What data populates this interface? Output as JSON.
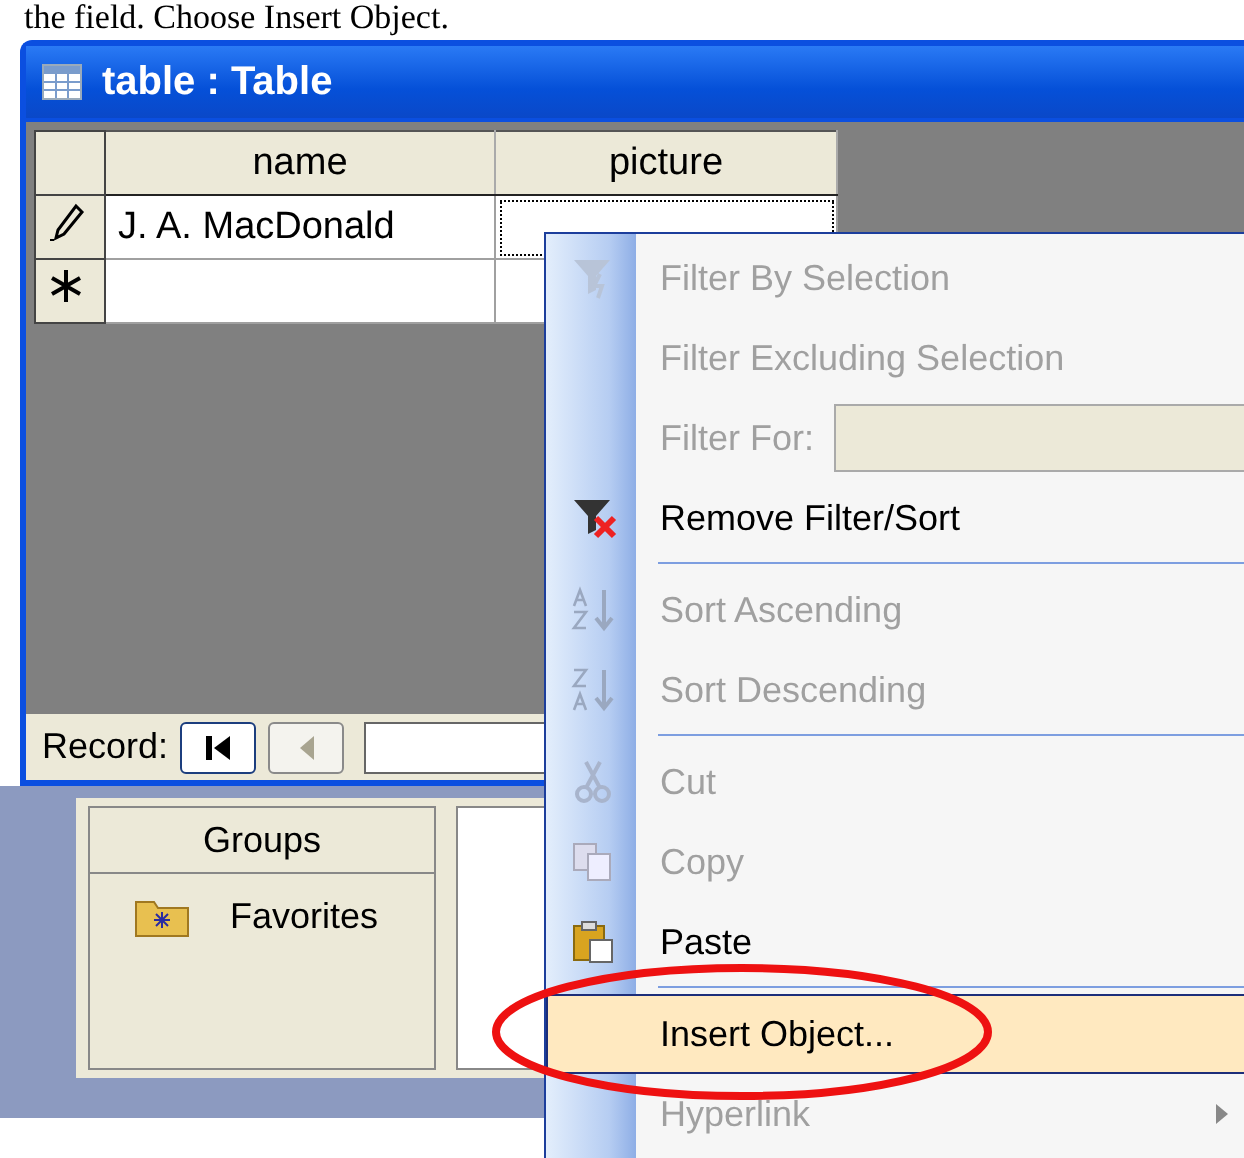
{
  "caption": "the field. Choose Insert Object.",
  "window": {
    "title": "table : Table"
  },
  "table": {
    "columns": [
      "name",
      "picture"
    ],
    "rows": [
      {
        "editing": true,
        "cells": [
          {
            "text": "J. A. MacDonald",
            "focused": false
          },
          {
            "focused": true
          }
        ]
      },
      {
        "editing": false,
        "cells": [
          {
            "focused": false
          },
          {
            "focused": false
          }
        ]
      }
    ]
  },
  "record_navigator": {
    "label": "Record:",
    "buttons": [
      {
        "kind": "first",
        "disabled": false
      },
      {
        "kind": "previous",
        "disabled": true
      }
    ]
  },
  "groups_panel": {
    "title": "Groups",
    "items": [
      {
        "label": "Favorites"
      }
    ]
  },
  "context_menu": {
    "items": [
      {
        "kind": "command",
        "label": "Filter By Selection",
        "disabled": true,
        "selected": false
      },
      {
        "kind": "command",
        "label": "Filter Excluding Selection",
        "disabled": true,
        "selected": false
      },
      {
        "kind": "field",
        "label": "Filter For:",
        "disabled": true,
        "selected": false
      },
      {
        "kind": "command",
        "label": "Remove Filter/Sort",
        "disabled": false,
        "selected": false
      },
      {
        "kind": "separator"
      },
      {
        "kind": "command",
        "label": "Sort Ascending",
        "disabled": true,
        "selected": false
      },
      {
        "kind": "command",
        "label": "Sort Descending",
        "disabled": true,
        "selected": false
      },
      {
        "kind": "separator"
      },
      {
        "kind": "command",
        "label": "Cut",
        "disabled": true,
        "selected": false
      },
      {
        "kind": "command",
        "label": "Copy",
        "disabled": true,
        "selected": false
      },
      {
        "kind": "command",
        "label": "Paste",
        "disabled": false,
        "selected": false
      },
      {
        "kind": "separator"
      },
      {
        "kind": "command",
        "label": "Insert Object...",
        "disabled": false,
        "selected": true
      },
      {
        "kind": "submenu",
        "label": "Hyperlink",
        "disabled": true,
        "selected": false
      }
    ]
  }
}
